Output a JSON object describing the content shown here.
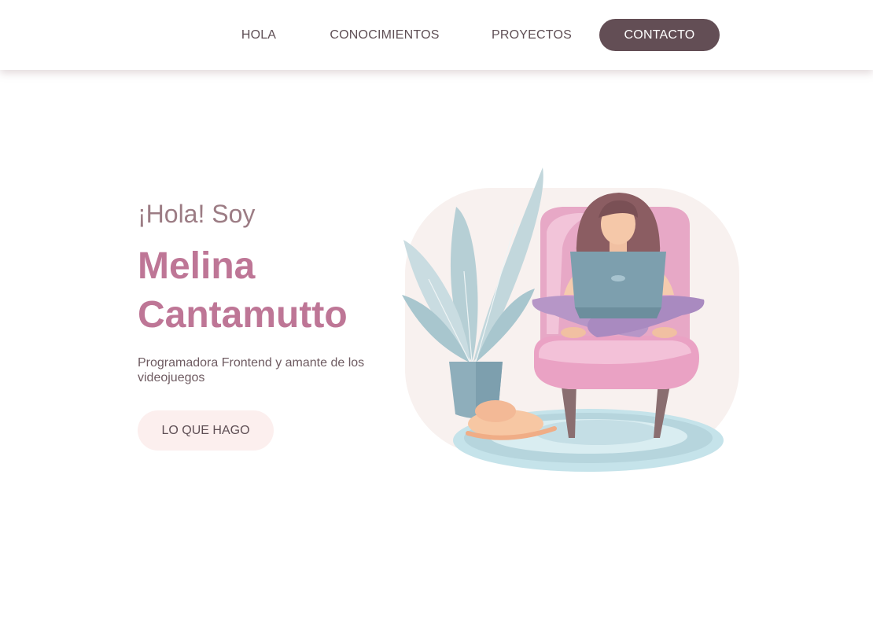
{
  "nav": {
    "items": [
      {
        "label": "HOLA"
      },
      {
        "label": "CONOCIMIENTOS"
      },
      {
        "label": "PROYECTOS"
      },
      {
        "label": "CONTACTO"
      }
    ],
    "active_color": "#634e55"
  },
  "hero": {
    "greeting": "¡Hola! Soy",
    "name_line1": "Melina",
    "name_line2": "Cantamutto",
    "tagline": "Programadora Frontend y amante de los videojuegos",
    "cta_label": "LO QUE HAGO"
  },
  "illustration": {
    "subject": "woman-with-laptop-on-armchair",
    "colors": {
      "accent": "#be7696",
      "blob": "#f8f1ef",
      "chair": "#eaa6c5",
      "rug": "#c5e3ea",
      "plant": "#b6cfd5",
      "pot": "#8eaebb",
      "cat": "#f7c7a3",
      "laptop": "#7d9fae"
    }
  }
}
